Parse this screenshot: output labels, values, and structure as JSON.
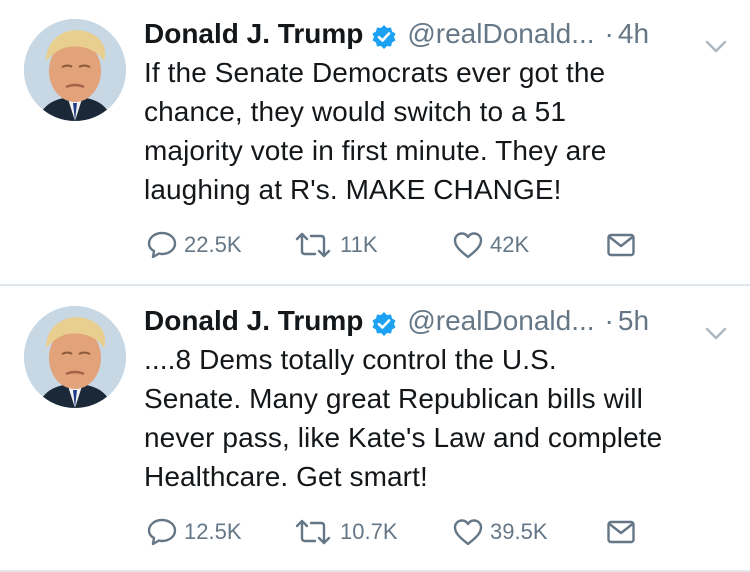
{
  "tweets": [
    {
      "name": "Donald J. Trump",
      "handle": "@realDonald...",
      "dot": "·",
      "time": "4h",
      "lines": [
        "If the Senate Democrats ever got the",
        "chance, they would switch to a 51",
        "majority vote in first minute. They are",
        "laughing at R's. MAKE CHANGE!"
      ],
      "replies": "22.5K",
      "retweets": "11K",
      "likes": "42K"
    },
    {
      "name": "Donald J. Trump",
      "handle": "@realDonald...",
      "dot": "·",
      "time": "5h",
      "lines": [
        "....8 Dems totally control the U.S.",
        "Senate. Many great Republican bills will",
        "never pass, like Kate's Law and complete",
        "Healthcare. Get smart!"
      ],
      "replies": "12.5K",
      "retweets": "10.7K",
      "likes": "39.5K"
    }
  ],
  "colors": {
    "verified": "#1da1f2",
    "secondary_text": "#657786",
    "divider": "#e1e8ed"
  },
  "icons": [
    "verified-badge-icon",
    "chevron-down-icon",
    "reply-icon",
    "retweet-icon",
    "like-icon",
    "direct-message-icon"
  ]
}
